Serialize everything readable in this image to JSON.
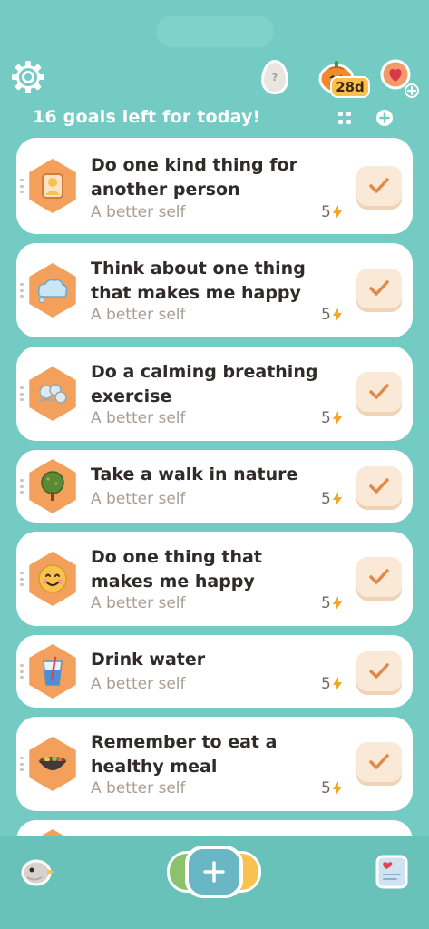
{
  "header": {
    "streak_label": "28d",
    "egg_label": "?",
    "goals_left_text": "16 goals left for today!"
  },
  "goals": [
    {
      "title": "Do one kind thing for another person",
      "category": "A better self",
      "points": "5",
      "icon": "helping-person-icon"
    },
    {
      "title": "Think about one thing that makes me happy",
      "category": "A better self",
      "points": "5",
      "icon": "thought-cloud-icon"
    },
    {
      "title": "Do a calming breathing exercise",
      "category": "A better self",
      "points": "5",
      "icon": "breath-wind-icon"
    },
    {
      "title": "Take a walk in nature",
      "category": "A better self",
      "points": "5",
      "icon": "tree-icon"
    },
    {
      "title": "Do one thing that makes me happy",
      "category": "A better self",
      "points": "5",
      "icon": "smiling-face-icon"
    },
    {
      "title": "Drink water",
      "category": "A better self",
      "points": "5",
      "icon": "water-glass-icon"
    },
    {
      "title": "Remember to eat a healthy meal",
      "category": "A better self",
      "points": "5",
      "icon": "food-bowl-icon"
    }
  ],
  "colors": {
    "background": "#73cbc3",
    "hex_badge": "#f2a05c",
    "check": "#e08a4a",
    "bolt": "#f5a623"
  }
}
